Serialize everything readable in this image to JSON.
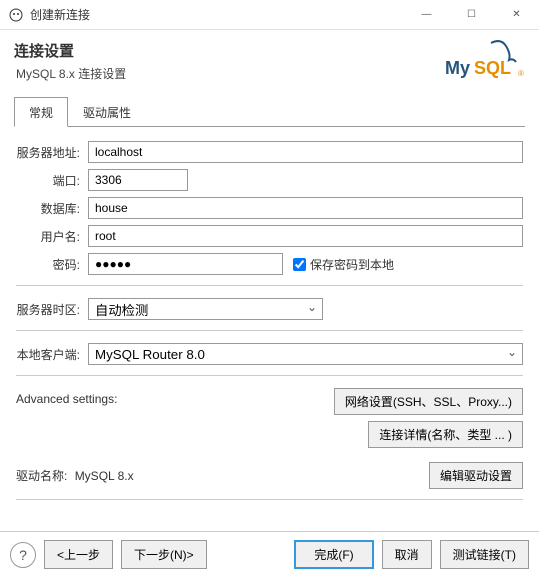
{
  "window": {
    "title": "创建新连接",
    "min": "—",
    "max": "☐",
    "close": "✕"
  },
  "header": {
    "title": "连接设置",
    "subtitle": "MySQL 8.x 连接设置"
  },
  "tabs": {
    "general": "常规",
    "driver": "驱动属性"
  },
  "fields": {
    "server_label": "服务器地址:",
    "server": "localhost",
    "port_label": "端口:",
    "port": "3306",
    "database_label": "数据库:",
    "database": "house",
    "username_label": "用户名:",
    "username": "root",
    "password_label": "密码:",
    "password": "●●●●●",
    "save_password": "保存密码到本地",
    "timezone_label": "服务器时区:",
    "timezone": "自动检测",
    "client_label": "本地客户端:",
    "client": "MySQL Router 8.0"
  },
  "advanced": {
    "label": "Advanced settings:",
    "network_btn": "网络设置(SSH、SSL、Proxy...)",
    "detail_btn": "连接详情(名称、类型 ... )"
  },
  "driver": {
    "label": "驱动名称:",
    "name": "MySQL 8.x",
    "edit_btn": "编辑驱动设置"
  },
  "footer": {
    "help": "?",
    "back": "<上一步",
    "next": "下一步(N)>",
    "finish": "完成(F)",
    "cancel": "取消",
    "test": "测试链接(T)"
  }
}
